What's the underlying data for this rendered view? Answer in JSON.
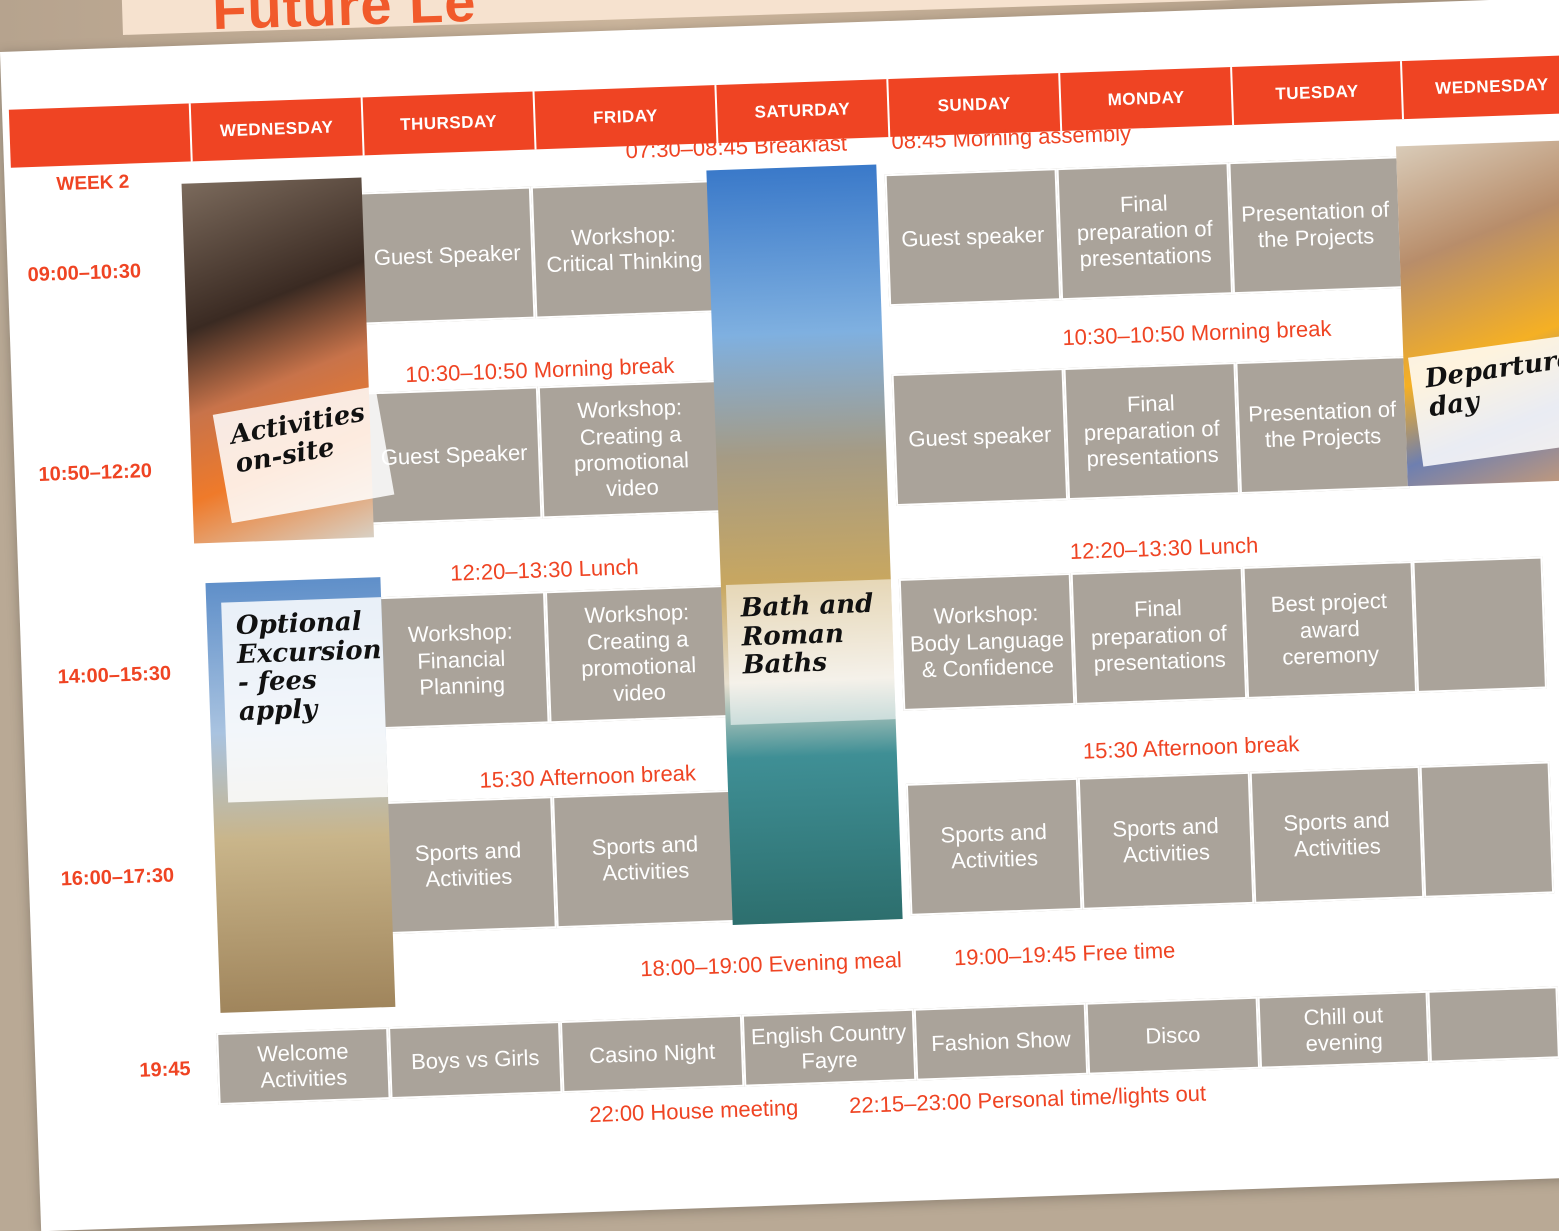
{
  "title": "Future Le",
  "week_label": "WEEK 2",
  "days": [
    "WEDNESDAY",
    "THURSDAY",
    "FRIDAY",
    "SATURDAY",
    "SUNDAY",
    "MONDAY",
    "TUESDAY",
    "WEDNESDAY"
  ],
  "times": {
    "t1": "09:00–10:30",
    "t2": "10:50–12:20",
    "t3": "14:00–15:30",
    "t4": "16:00–17:30",
    "t5": "19:45"
  },
  "banners": {
    "breakfast": "07:30–08:45 Breakfast",
    "assembly": "08:45 Morning assembly",
    "break_left": "10:30–10:50 Morning break",
    "break_right": "10:30–10:50 Morning break",
    "lunch_left": "12:20–13:30 Lunch",
    "lunch_right": "12:20–13:30 Lunch",
    "afternoon_left": "15:30 Afternoon break",
    "afternoon_right": "15:30 Afternoon break",
    "evening_meal": "18:00–19:00  Evening meal",
    "free_time": "19:00–19:45 Free time",
    "house_meeting": "22:00 House meeting",
    "lights_out": "22:15–23:00 Personal time/lights out"
  },
  "cells": {
    "thu_1": "Guest Speaker",
    "fri_1": "Workshop: Critical Thinking",
    "sun_1": "Guest speaker",
    "mon_1": "Final preparation of presentations",
    "tue_1": "Presentation of the Projects",
    "thu_2": "Guest Speaker",
    "fri_2": "Workshop: Creating a promotional video",
    "sun_2": "Guest speaker",
    "mon_2": "Final preparation of presentations",
    "tue_2": "Presentation of the Projects",
    "thu_3": "Workshop: Financial Planning",
    "fri_3": "Workshop: Creating a promotional video",
    "sun_3": "Workshop: Body Language & Confidence",
    "mon_3": "Final preparation of presentations",
    "tue_3": "Best project award ceremony",
    "thu_4": "Sports and Activities",
    "fri_4": "Sports and Activities",
    "sun_4": "Sports and Activities",
    "mon_4": "Sports and Activities",
    "tue_4": "Sports and Activities",
    "wed_5": "Welcome Activities",
    "thu_5": "Boys vs Girls",
    "fri_5": "Casino Night",
    "sat_5": "English Country Fayre",
    "sun_5": "Fashion Show",
    "mon_5": "Disco",
    "tue_5": "Chill out evening"
  },
  "notes": {
    "activities": "Activities on-site",
    "excursion": "Optional Excursion - fees apply",
    "bath": "Bath and Roman Baths",
    "departures": "Departures day"
  },
  "colors": {
    "accent": "#ef4423",
    "cell": "#aaa39a"
  }
}
